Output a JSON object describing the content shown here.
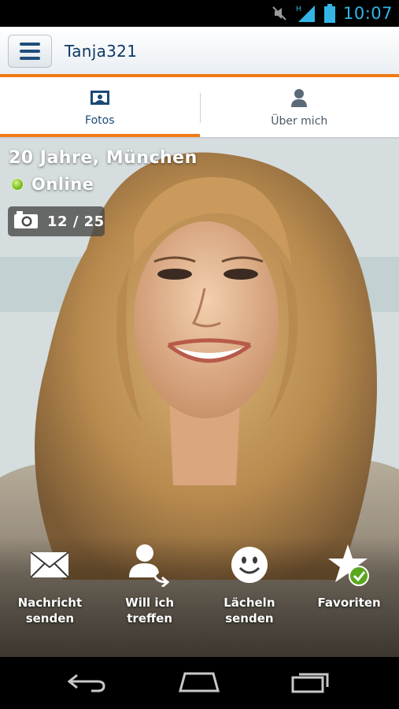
{
  "status_bar": {
    "time": "10:07",
    "icons": [
      "mute-icon",
      "signal-icon",
      "battery-icon"
    ],
    "network_type": "H"
  },
  "action_bar": {
    "title": "Tanja321",
    "menu_icon": "hamburger-icon"
  },
  "tabs": [
    {
      "label": "Fotos",
      "icon": "photos-icon",
      "active": true
    },
    {
      "label": "Über mich",
      "icon": "person-icon",
      "active": false
    }
  ],
  "profile": {
    "age_location": "20 Jahre, München",
    "status": "Online",
    "photo_counter": "12 / 25"
  },
  "actions": [
    {
      "label": "Nachricht\nsenden",
      "icon": "envelope-icon"
    },
    {
      "label": "Will ich\ntreffen",
      "icon": "meet-person-icon"
    },
    {
      "label": "Lächeln\nsenden",
      "icon": "smiley-icon"
    },
    {
      "label": "Favoriten",
      "icon": "star-check-icon"
    }
  ],
  "nav_bar": {
    "icons": [
      "back-icon",
      "home-icon",
      "recent-apps-icon"
    ]
  },
  "colors": {
    "accent_orange": "#f07a14",
    "title_blue": "#0f3a66",
    "status_blue": "#33b5e5",
    "online_green": "#7cbd24"
  }
}
